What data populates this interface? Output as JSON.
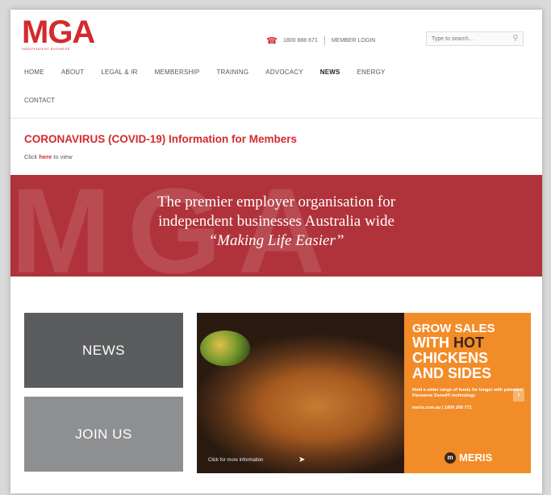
{
  "header": {
    "logo": "MGA",
    "logo_sub": "INDEPENDENT BUSINESS",
    "phone": "1800 888 671",
    "member_login": "MEMBER LOGIN",
    "search_placeholder": "Type to search..."
  },
  "nav": {
    "items": [
      "HOME",
      "ABOUT",
      "LEGAL & IR",
      "MEMBERSHIP",
      "TRAINING",
      "ADVOCACY",
      "NEWS",
      "ENERGY"
    ],
    "item2": "CONTACT",
    "active": "NEWS"
  },
  "notice": {
    "title": "CORONAVIRUS (COVID-19) Information for Members",
    "sub_prefix": "Click ",
    "sub_link": "here",
    "sub_suffix": " to view"
  },
  "banner": {
    "line1": "The premier employer organisation for",
    "line2": "independent businesses Australia wide",
    "tagline": "“Making Life Easier”",
    "bg_letters": "MGA"
  },
  "tiles": {
    "news": "NEWS",
    "join": "JOIN US"
  },
  "ad": {
    "line1": "GROW SALES",
    "line2a": "WITH",
    "line2b": "HOT",
    "line3": "CHICKENS",
    "line4": "AND SIDES",
    "small": "Hold a wider range of foods for longer with patented Flexserve Zoned® technology",
    "contact": "meris.com.au | 1800 268 771",
    "brand": "MERIS",
    "caption": "Click for more information",
    "colors": {
      "panel": "#f28c28",
      "dark": "#3a2618"
    }
  },
  "colors": {
    "brand_red": "#d42a2e",
    "banner": "#b0333b",
    "tile_news": "#5a5c5e",
    "tile_join": "#8e8f91"
  }
}
